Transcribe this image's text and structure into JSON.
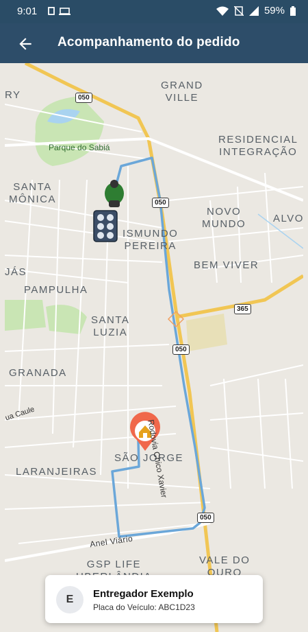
{
  "status_bar": {
    "time": "9:01",
    "battery": "59%"
  },
  "header": {
    "title": "Acompanhamento do pedido"
  },
  "map": {
    "labels": {
      "grand_ville": "GRAND\nVILLE",
      "ry": "RY",
      "residencial": "RESIDENCIAL\nINTEGRAÇÃO",
      "parque": "Parque do Sabiá",
      "santa_monica": "SANTA\nMÔNICA",
      "segismundo": "ISMUNDO\nPEREIRA",
      "novo_mundo": "NOVO\nMUNDO",
      "alvo": "ALVO",
      "bem_viver": "BEM VIVER",
      "jas": "JÁS",
      "pampulha": "PAMPULHA",
      "santa_luzia": "SANTA\nLUZIA",
      "granada": "GRANADA",
      "sao_jorge": "SÃO JORGE",
      "laranjeiras": "LARANJEIRAS",
      "vale_do_ouro": "VALE DO\nOURO",
      "gsp_life": "GSP LIFE\nUBERLÂNDIA",
      "rodovia": "Rodovia Chico Xavier",
      "anel_viario": "Anel Viário",
      "caule": "ua Caule"
    },
    "shields": [
      "050",
      "050",
      "365",
      "050",
      "050"
    ]
  },
  "driver": {
    "initial": "E",
    "name": "Entregador Exemplo",
    "plate": "Placa do Veículo: ABC1D23"
  }
}
